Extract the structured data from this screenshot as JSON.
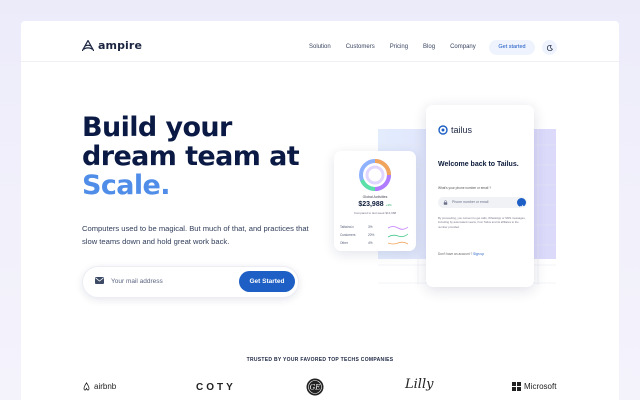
{
  "nav": {
    "brand": "ampire",
    "menu": [
      "Solution",
      "Customers",
      "Pricing",
      "Blog",
      "Company"
    ],
    "cta": "Get started",
    "theme_icon": "moon-icon"
  },
  "hero": {
    "title_line1": "Build your",
    "title_line2": "dream team at",
    "title_accent": "Scale.",
    "subtitle": "Computers used to be magical. But much of that, and practices that slow teams down and hold great work back.",
    "email_placeholder": "Your mail address",
    "email_button": "Get Started",
    "accent_color": "#4f8de8"
  },
  "stats_card": {
    "label": "Global Activities",
    "value": "$23,988",
    "change": "+4%",
    "comparison": "Compared to last week $13,988",
    "rows": [
      {
        "name": "Tailwind.v",
        "pct": "3%"
      },
      {
        "name": "Customers",
        "pct": "20%"
      },
      {
        "name": "Other",
        "pct": "4%"
      }
    ]
  },
  "login_card": {
    "brand": "tailus",
    "welcome": "Welcome back to Tailus.",
    "phone_label": "What's your phone number or email ?",
    "phone_placeholder": "Phone number or email",
    "legal": "By proceeding, you consent to get calls, WhatsApp or SMS messages, including by automated means, from Tailus and its affiliates to the number provided.",
    "signup_text": "Don't have an account ?",
    "signup_link": "Sign up"
  },
  "trusted": {
    "heading": "TRUSTED BY YOUR FAVORED TOP TECHS COMPANIES",
    "logos": [
      "airbnb",
      "COTY",
      "GE",
      "Lilly",
      "Microsoft"
    ]
  }
}
